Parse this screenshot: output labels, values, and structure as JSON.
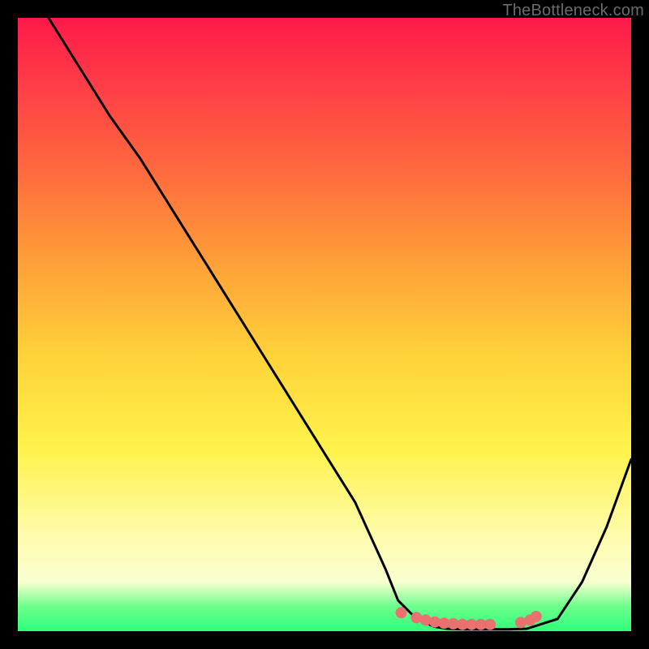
{
  "attribution": "TheBottleneck.com",
  "colors": {
    "page_bg": "#000000",
    "gradient_top": "#ff1a49",
    "gradient_mid1": "#ff6a3e",
    "gradient_mid2": "#ffd23a",
    "gradient_mid3": "#fffcb0",
    "gradient_bottom": "#2fff7a",
    "curve_stroke": "#000000",
    "marker_fill": "#e9716f",
    "marker_stroke": "#e9716f"
  },
  "chart_data": {
    "type": "line",
    "title": "",
    "xlabel": "",
    "ylabel": "",
    "xlim": [
      0,
      100
    ],
    "ylim": [
      0,
      100
    ],
    "series": [
      {
        "name": "bottleneck-curve",
        "x": [
          5,
          10,
          15,
          20,
          25,
          30,
          35,
          40,
          45,
          50,
          55,
          60,
          62,
          65,
          68,
          70,
          73,
          76,
          80,
          83,
          88,
          92,
          96,
          100
        ],
        "y": [
          100,
          92,
          84,
          77,
          69,
          61,
          53,
          45,
          37,
          29,
          21,
          10,
          5,
          2,
          0.7,
          0.4,
          0.3,
          0.3,
          0.3,
          0.4,
          2,
          8,
          17,
          28
        ]
      }
    ],
    "markers": {
      "name": "optimal-range-dots",
      "x": [
        62.5,
        65,
        66.5,
        68,
        69.5,
        71,
        72.5,
        74,
        75.5,
        77,
        82,
        83.5,
        84.5
      ],
      "y": [
        3.0,
        2.2,
        1.8,
        1.5,
        1.3,
        1.2,
        1.1,
        1.1,
        1.1,
        1.1,
        1.4,
        1.8,
        2.4
      ]
    }
  }
}
